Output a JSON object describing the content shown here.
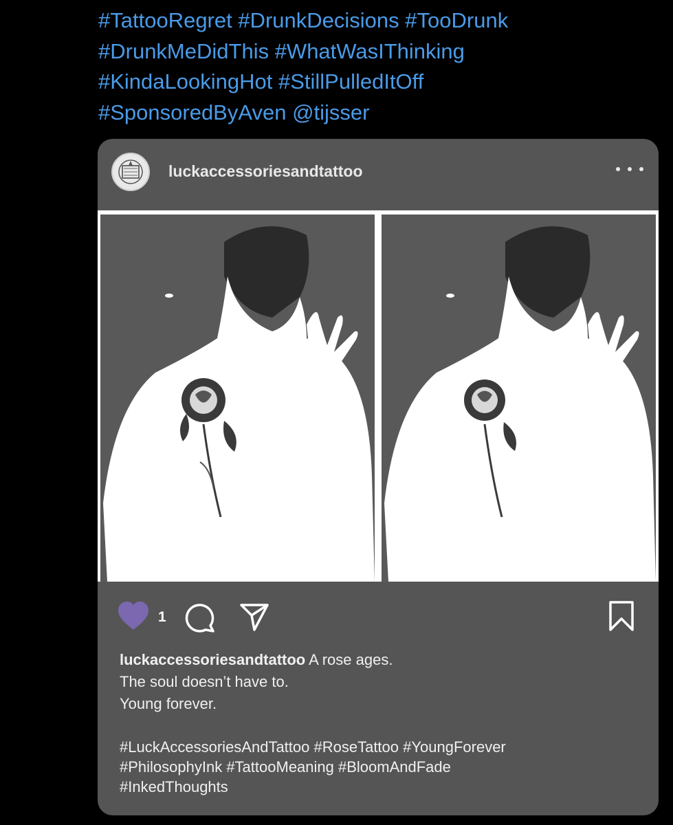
{
  "tweet": {
    "hashtag_lines": [
      "#TattooRegret #DrunkDecisions #TooDrunk",
      "#DrunkMeDidThis #WhatWasIThinking",
      "#KindaLookingHot #StillPulledItOff",
      "#SponsoredByAven @tijsser"
    ],
    "link_color": "#4a9be8"
  },
  "post": {
    "username": "luckaccessoriesandtattoo",
    "avatar_icon": "shop-logo-icon",
    "more_icon": "more-options-icon",
    "like_count": "1",
    "like_color": "#7b68b0",
    "caption": {
      "username": "luckaccessoriesandtattoo",
      "lines": [
        "A rose ages.",
        "The soul doesn’t have to.",
        "Young forever."
      ],
      "hashtag_lines": [
        "#LuckAccessoriesAndTattoo #RoseTattoo #YoungForever",
        "#PhilosophyInk #TattooMeaning #BloomAndFade",
        "#InkedThoughts"
      ]
    },
    "card_color": "#555555"
  }
}
